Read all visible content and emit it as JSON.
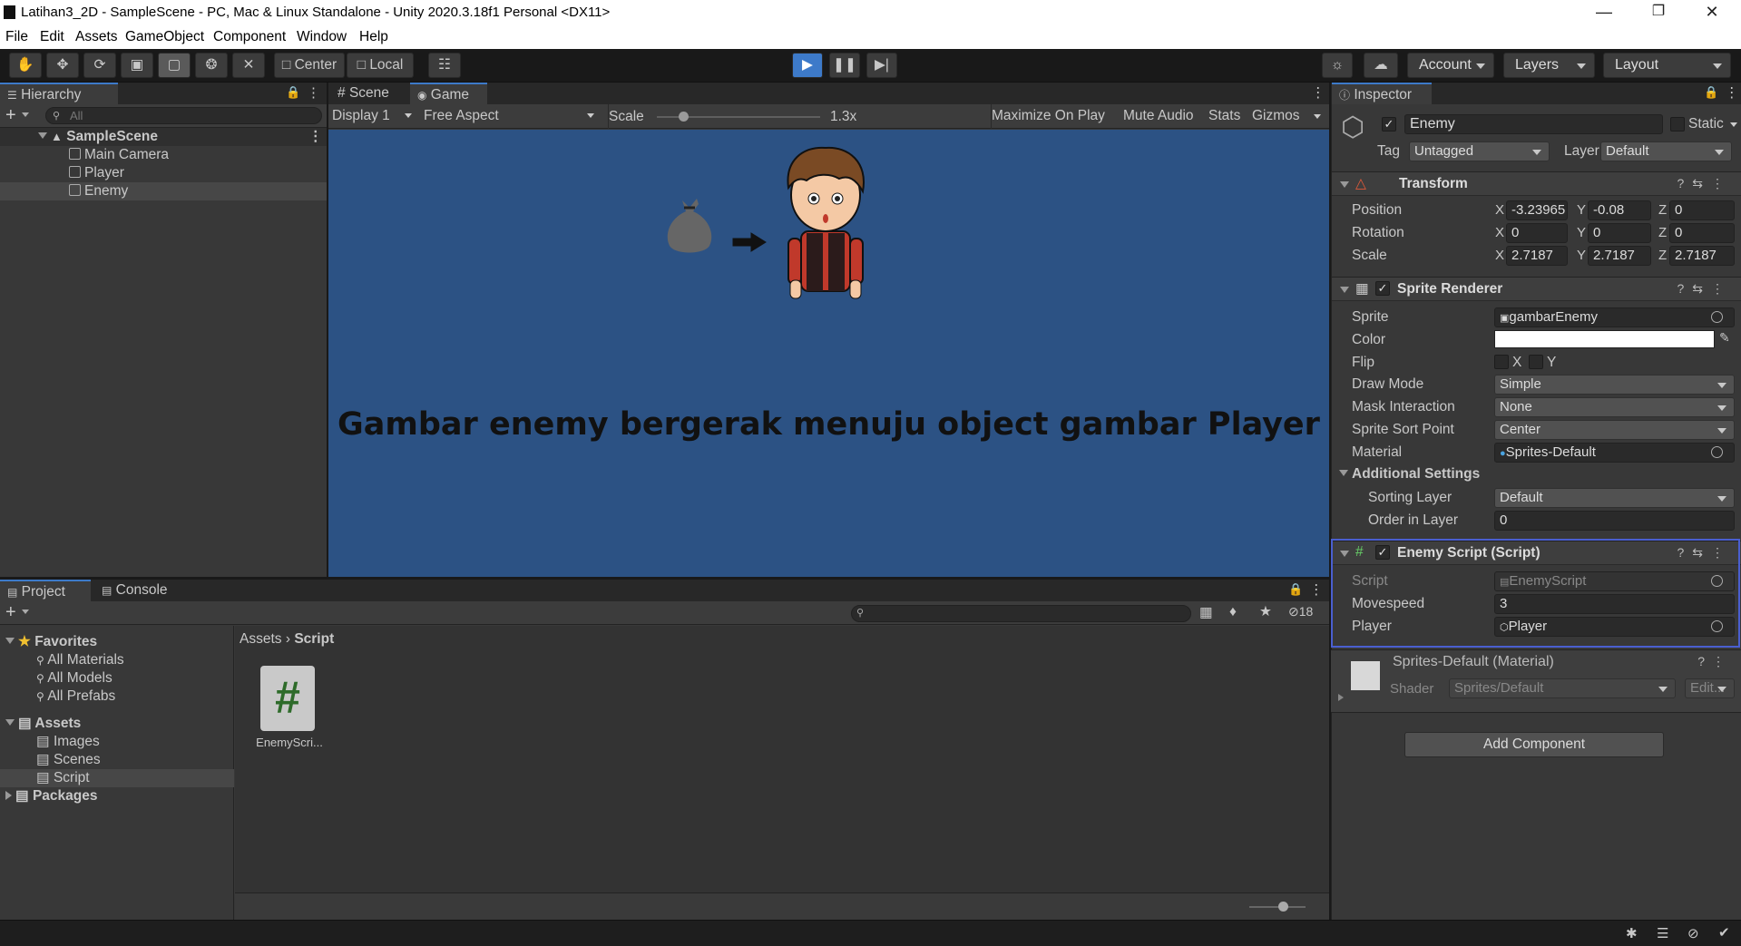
{
  "window": {
    "title": "Latihan3_2D - SampleScene - PC, Mac & Linux Standalone - Unity 2020.3.18f1 Personal <DX11>"
  },
  "menu": [
    "File",
    "Edit",
    "Assets",
    "GameObject",
    "Component",
    "Window",
    "Help"
  ],
  "toolbar": {
    "pivot": "Center",
    "space": "Local",
    "account": "Account",
    "layers": "Layers",
    "layout": "Layout"
  },
  "hierarchy": {
    "tab": "Hierarchy",
    "search_placeholder": "All",
    "scene": "SampleScene",
    "items": [
      "Main Camera",
      "Player",
      "Enemy"
    ]
  },
  "game_view": {
    "tabs": [
      "Scene",
      "Game"
    ],
    "display": "Display 1",
    "aspect": "Free Aspect",
    "scale_label": "Scale",
    "scale_value": "1.3x",
    "scale_fraction": 0.16,
    "toggles": [
      "Maximize On Play",
      "Mute Audio",
      "Stats",
      "Gizmos"
    ],
    "caption": "Gambar enemy bergerak menuju object gambar Player"
  },
  "project": {
    "tabs": [
      "Project",
      "Console"
    ],
    "hidden_count": "18",
    "favorites_label": "Favorites",
    "favorites": [
      "All Materials",
      "All Models",
      "All Prefabs"
    ],
    "assets_label": "Assets",
    "folders": [
      "Images",
      "Scenes",
      "Script"
    ],
    "packages_label": "Packages",
    "breadcrumb": [
      "Assets",
      "Script"
    ],
    "file_name": "EnemyScri...",
    "file_glyph": "#"
  },
  "inspector": {
    "tab": "Inspector",
    "object_name": "Enemy",
    "static_label": "Static",
    "tag_label": "Tag",
    "tag_value": "Untagged",
    "layer_label": "Layer",
    "layer_value": "Default",
    "transform": {
      "title": "Transform",
      "position_label": "Position",
      "position": [
        "-3.23965",
        "-0.08",
        "0"
      ],
      "rotation_label": "Rotation",
      "rotation": [
        "0",
        "0",
        "0"
      ],
      "scale_label": "Scale",
      "scale": [
        "2.7187",
        "2.7187",
        "2.7187"
      ]
    },
    "sprite_renderer": {
      "title": "Sprite Renderer",
      "sprite_label": "Sprite",
      "sprite": "gambarEnemy",
      "color_label": "Color",
      "color_value": "#ffffff",
      "flip_label": "Flip",
      "flip_x": "X",
      "flip_y": "Y",
      "draw_mode_label": "Draw Mode",
      "draw_mode": "Simple",
      "mask_label": "Mask Interaction",
      "mask": "None",
      "sort_point_label": "Sprite Sort Point",
      "sort_point": "Center",
      "material_label": "Material",
      "material": "Sprites-Default",
      "additional": "Additional Settings",
      "sorting_layer_label": "Sorting Layer",
      "sorting_layer": "Default",
      "order_label": "Order in Layer",
      "order": "0"
    },
    "enemy_script": {
      "title": "Enemy Script (Script)",
      "script_label": "Script",
      "script": "EnemyScript",
      "movespeed_label": "Movespeed",
      "movespeed": "3",
      "player_label": "Player",
      "player": "Player"
    },
    "material": {
      "title": "Sprites-Default (Material)",
      "shader_label": "Shader",
      "shader": "Sprites/Default",
      "edit": "Edit..."
    },
    "add_component": "Add Component"
  },
  "colors": {
    "scene_bg": "#2c5284",
    "accent": "#3d7ac9",
    "highlight_border": "#4a5fd0"
  }
}
